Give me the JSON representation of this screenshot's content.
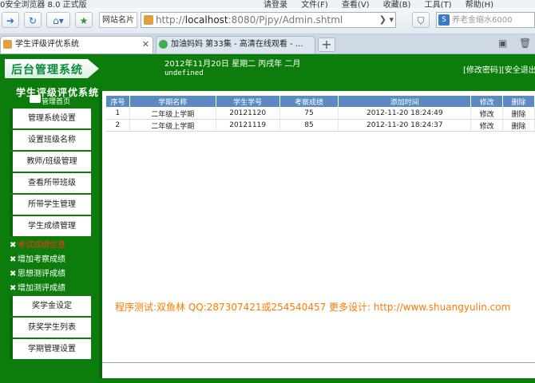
{
  "browser": {
    "app_title": "0安全浏览器 8.0 正式版",
    "menu": [
      "请登录",
      "文件(F)",
      "查看(V)",
      "收藏(B)",
      "工具(T)",
      "帮助(H)"
    ],
    "favorites_label": "网站名片",
    "url_prefix": "http://",
    "url_host": "localhost",
    "url_path": ":8080/Pjpy/Admin.shtml",
    "search_text": "养老金缩水6000",
    "tabs": [
      {
        "title": "学生评级评优系统",
        "active": true
      },
      {
        "title": "加油妈妈 第33集 - 高清在线观看 - ...",
        "active": false
      }
    ]
  },
  "page": {
    "logo_text": "后台管理系统",
    "date_text": "2012年11月20日 星期二 丙戌年 二月",
    "undefined_text": "undefined",
    "links": {
      "change_password": "[修改密码]",
      "logout": "[安全退出]"
    },
    "system_title": "学生评级评优系统",
    "home_link": "管理首页",
    "sidebar_buttons_top": [
      "管理系统设置",
      "设置班级名称",
      "教师/班级管理",
      "查看所带班级",
      "所带学生管理",
      "学生成绩管理"
    ],
    "sidebar_subitems": [
      {
        "label": "考试成绩信息",
        "active": true
      },
      {
        "label": "增加考察成绩",
        "active": false
      },
      {
        "label": "思想测评成绩",
        "active": false
      },
      {
        "label": "增加测评成绩",
        "active": false
      }
    ],
    "sidebar_buttons_bottom": [
      "奖学金设定",
      "获奖学生列表",
      "学期管理设置"
    ],
    "table": {
      "headers": [
        "序号",
        "学期名称",
        "学生学号",
        "考察成绩",
        "添加时间",
        "修改",
        "删除"
      ],
      "rows": [
        [
          "1",
          "二年级上学期",
          "20121120",
          "75",
          "2012-11-20 18:24:49",
          "修改",
          "删除"
        ],
        [
          "2",
          "二年级上学期",
          "20121119",
          "85",
          "2012-11-20 18:24:37",
          "修改",
          "删除"
        ]
      ]
    },
    "credit": "程序测试:双鱼林 QQ:287307421或254540457 更多设计: http://www.shuangyulin.com"
  }
}
